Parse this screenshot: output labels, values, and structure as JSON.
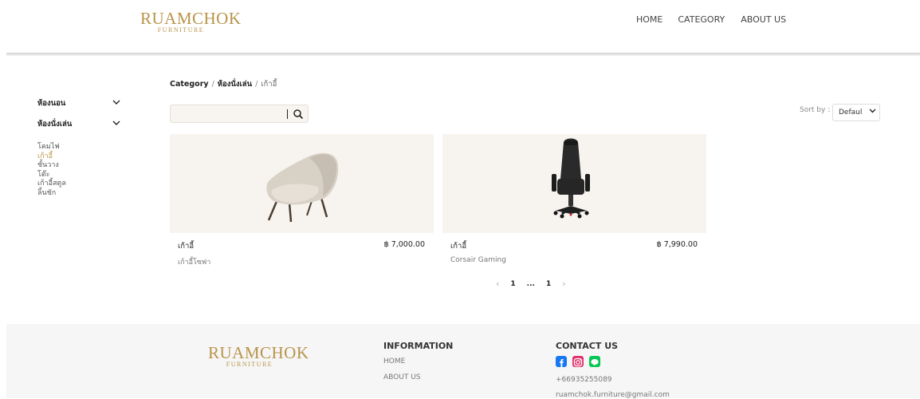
{
  "header": {
    "logo_main": "RUAMCHOK",
    "logo_sub": "FURNITURE",
    "nav": [
      "HOME",
      "CATEGORY",
      "ABOUT US"
    ]
  },
  "sidebar": {
    "categories": [
      {
        "label": "ห้องนอน"
      },
      {
        "label": "ห้องนั่งเล่น"
      }
    ],
    "subitems": [
      "โคมไฟ",
      "เก้าอี้",
      "ชั้นวาง",
      "โต๊ะ",
      "เก้าอี้สตูล",
      "ลิ้นชัก"
    ],
    "active_subitem": "เก้าอี้"
  },
  "breadcrumb": {
    "root": "Category",
    "sep": "/",
    "middle": "ห้องนั่งเล่น",
    "current": "เก้าอี้"
  },
  "search": {
    "value": "",
    "placeholder": ""
  },
  "sort": {
    "label": "Sort by :",
    "value": "Defaul"
  },
  "products": [
    {
      "name": "เก้าอี้",
      "price": "฿ 7,000.00",
      "desc": "เก้าอี้โซฟา"
    },
    {
      "name": "เก้าอี้",
      "price": "฿ 7,990.00",
      "desc": "Corsair Gaming"
    }
  ],
  "pagination": {
    "prev": "‹",
    "first": "1",
    "ellipsis": "...",
    "last": "1",
    "next": "›"
  },
  "footer": {
    "logo_main": "RUAMCHOK",
    "logo_sub": "FURNITURE",
    "info_title": "INFORMATION",
    "info_links": [
      "HOME",
      "ABOUT US"
    ],
    "contact_title": "CONTACT US",
    "phone": "+66935255089",
    "email": "ruamchok.furniture@gmail.com",
    "social_icons": [
      "facebook-icon",
      "instagram-icon",
      "line-icon"
    ]
  },
  "colors": {
    "brand_gold": "#b8944a",
    "card_bg": "#f7f4f0",
    "footer_bg": "#f6f6f6",
    "facebook": "#1877f2",
    "instagram": "#e1306c",
    "line": "#06c755"
  }
}
